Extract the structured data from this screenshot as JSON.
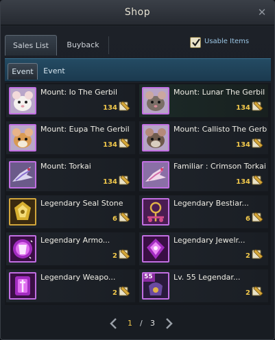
{
  "window": {
    "title": "Shop"
  },
  "tabs": [
    {
      "label": "Sales List",
      "active": true
    },
    {
      "label": "Buyback",
      "active": false
    }
  ],
  "usable_items": {
    "label": "Usable Items",
    "checked": true
  },
  "subtabs": [
    {
      "label": "Event",
      "active": true
    },
    {
      "label": "Event",
      "active": false
    }
  ],
  "items": [
    {
      "name": "Mount: Io The Gerbil",
      "price": "134",
      "icon": "white-gerbil-icon"
    },
    {
      "name": "Mount: Lunar The Gerbil",
      "price": "134",
      "icon": "gray-gerbil-icon"
    },
    {
      "name": "Mount: Eupa The Gerbil",
      "price": "134",
      "icon": "orange-gerbil-icon"
    },
    {
      "name": "Mount: Callisto The Gerbil",
      "price": "134",
      "icon": "brown-gerbil-icon"
    },
    {
      "name": "Mount: Torkai",
      "price": "134",
      "icon": "torkai-icon"
    },
    {
      "name": "Familiar : Crimson Torkai",
      "price": "134",
      "icon": "crimson-torkai-icon"
    },
    {
      "name": "Legendary Seal Stone",
      "price": "6",
      "icon": "seal-stone-icon"
    },
    {
      "name": "Legendary Bestiar...",
      "price": "6",
      "icon": "bestiary-icon"
    },
    {
      "name": "Legendary Armo...",
      "price": "2",
      "icon": "armor-box-icon"
    },
    {
      "name": "Legendary Jewelr...",
      "price": "2",
      "icon": "jewelry-box-icon"
    },
    {
      "name": "Legendary Weapo...",
      "price": "2",
      "icon": "weapon-box-icon"
    },
    {
      "name": "Lv. 55 Legendar...",
      "price": "2",
      "icon": "lv55-pouch-icon",
      "badge": "55"
    }
  ],
  "pager": {
    "current": "1",
    "separator": "/",
    "total": "3"
  }
}
